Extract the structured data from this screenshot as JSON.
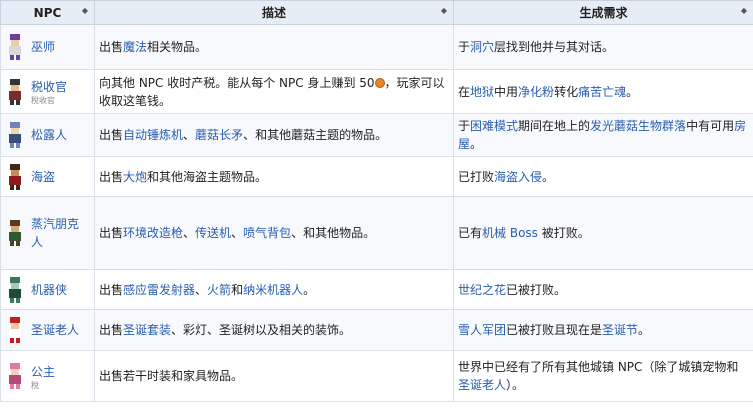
{
  "headers": {
    "npc": "NPC",
    "desc": "描述",
    "req": "生成需求",
    "sort_icon": "◆"
  },
  "rows": [
    {
      "name": "巫师",
      "sub": "",
      "desc": [
        "出售",
        {
          "l": "魔法"
        },
        "相关物品。"
      ],
      "req": [
        "于",
        {
          "l": "洞穴"
        },
        "层找到他并与其对话。"
      ]
    },
    {
      "name": "税收官",
      "sub": "稅收官",
      "desc": [
        "向其他 NPC 收时产税。能从每个 NPC 身上赚到 50",
        {
          "coin": true
        },
        "，玩家可以收取这笔钱。"
      ],
      "req": [
        "在",
        {
          "l": "地狱"
        },
        "中用",
        {
          "l": "净化粉"
        },
        "转化",
        {
          "l": "痛苦亡魂"
        },
        "。"
      ]
    },
    {
      "name": "松露人",
      "sub": "",
      "desc": [
        "出售",
        {
          "l": "自动锤炼机"
        },
        "、",
        {
          "l": "蘑菇长矛"
        },
        "、和其他蘑菇主题的物品。"
      ],
      "req": [
        "于",
        {
          "l": "困难模式"
        },
        "期间在地上的",
        {
          "l": "发光蘑菇生物群落"
        },
        "中有可用",
        {
          "l": "房屋"
        },
        "。"
      ]
    },
    {
      "name": "海盗",
      "sub": "",
      "desc": [
        "出售",
        {
          "l": "大炮"
        },
        "和其他海盗主题物品。"
      ],
      "req": [
        "已打败",
        {
          "l": "海盗入侵"
        },
        "。"
      ]
    },
    {
      "name": "蒸汽朋克人",
      "sub": "",
      "desc": [
        "出售",
        {
          "l": "环境改造枪"
        },
        "、",
        {
          "l": "传送机"
        },
        "、",
        {
          "l": "喷气背包"
        },
        "、和其他物品。"
      ],
      "req": [
        "已有",
        {
          "l": "机械 Boss"
        },
        " 被打败。"
      ]
    },
    {
      "name": "机器侠",
      "sub": "",
      "desc": [
        "出售",
        {
          "l": "感应雷发射器"
        },
        "、",
        {
          "l": "火箭"
        },
        "和",
        {
          "l": "纳米机器人"
        },
        "。"
      ],
      "req": [
        {
          "l": "世纪之花"
        },
        "已被打败。"
      ]
    },
    {
      "name": "圣诞老人",
      "sub": "",
      "desc": [
        "出售",
        {
          "l": "圣诞套装"
        },
        "、彩灯、圣诞树以及相关的装饰。"
      ],
      "req": [
        {
          "l": "雪人军团"
        },
        "已被打败且现在是",
        {
          "l": "圣诞节"
        },
        "。"
      ]
    },
    {
      "name": "公主",
      "sub": "稅",
      "desc": [
        "出售若干时装和家具物品。"
      ],
      "req": [
        "世界中已经有了所有其他城镇 NPC（除了城镇宠物和",
        {
          "l": "圣诞老人"
        },
        "）。"
      ]
    }
  ],
  "colors": {
    "link": "#2a5db0",
    "header_bg": "#e6edf5"
  }
}
